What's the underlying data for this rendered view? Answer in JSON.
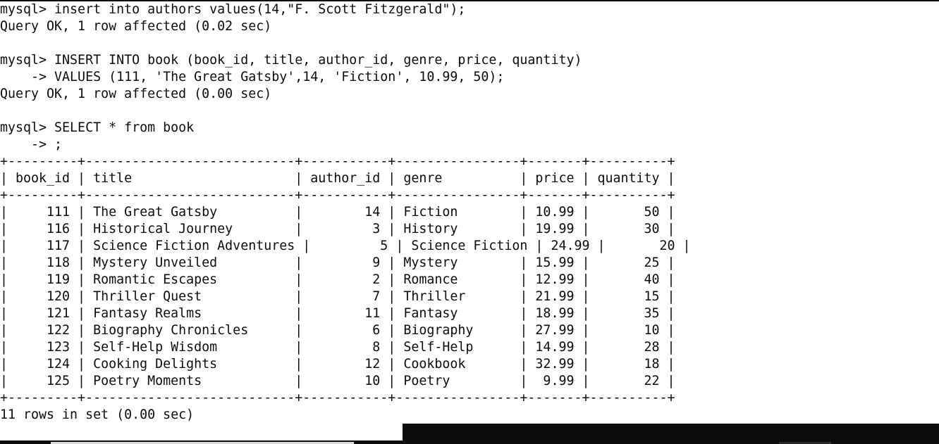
{
  "terminal": {
    "lines": [
      "mysql> insert into authors values(14,\"F. Scott Fitzgerald\");",
      "Query OK, 1 row affected (0.02 sec)",
      "",
      "mysql> INSERT INTO book (book_id, title, author_id, genre, price, quantity)",
      "    -> VALUES (111, 'The Great Gatsby',14, 'Fiction', 10.99, 50);",
      "Query OK, 1 row affected (0.00 sec)",
      "",
      "mysql> SELECT * from book",
      "    -> ;",
      "+---------+---------------------------+-----------+----------------+-------+----------+",
      "| book_id | title                     | author_id | genre          | price | quantity |",
      "+---------+---------------------------+-----------+----------------+-------+----------+",
      "|     111 | The Great Gatsby          |        14 | Fiction        | 10.99 |       50 |",
      "|     116 | Historical Journey        |         3 | History        | 19.99 |       30 |",
      "|     117 | Science Fiction Adventures |         5 | Science Fiction | 24.99 |       20 |",
      "|     118 | Mystery Unveiled          |         9 | Mystery        | 15.99 |       25 |",
      "|     119 | Romantic Escapes          |         2 | Romance        | 12.99 |       40 |",
      "|     120 | Thriller Quest            |         7 | Thriller       | 21.99 |       15 |",
      "|     121 | Fantasy Realms            |        11 | Fantasy        | 18.99 |       35 |",
      "|     122 | Biography Chronicles      |         6 | Biography      | 27.99 |       10 |",
      "|     123 | Self-Help Wisdom          |         8 | Self-Help      | 14.99 |       28 |",
      "|     124 | Cooking Delights          |        12 | Cookbook       | 32.99 |       18 |",
      "|     125 | Poetry Moments            |        10 | Poetry         |  9.99 |       22 |",
      "+---------+---------------------------+-----------+----------------+-------+----------+",
      "11 rows in set (0.00 sec)"
    ]
  },
  "colors": {
    "background": "#ffffff",
    "text": "#0c0c0c",
    "taskbar": "#0c0c0c"
  }
}
